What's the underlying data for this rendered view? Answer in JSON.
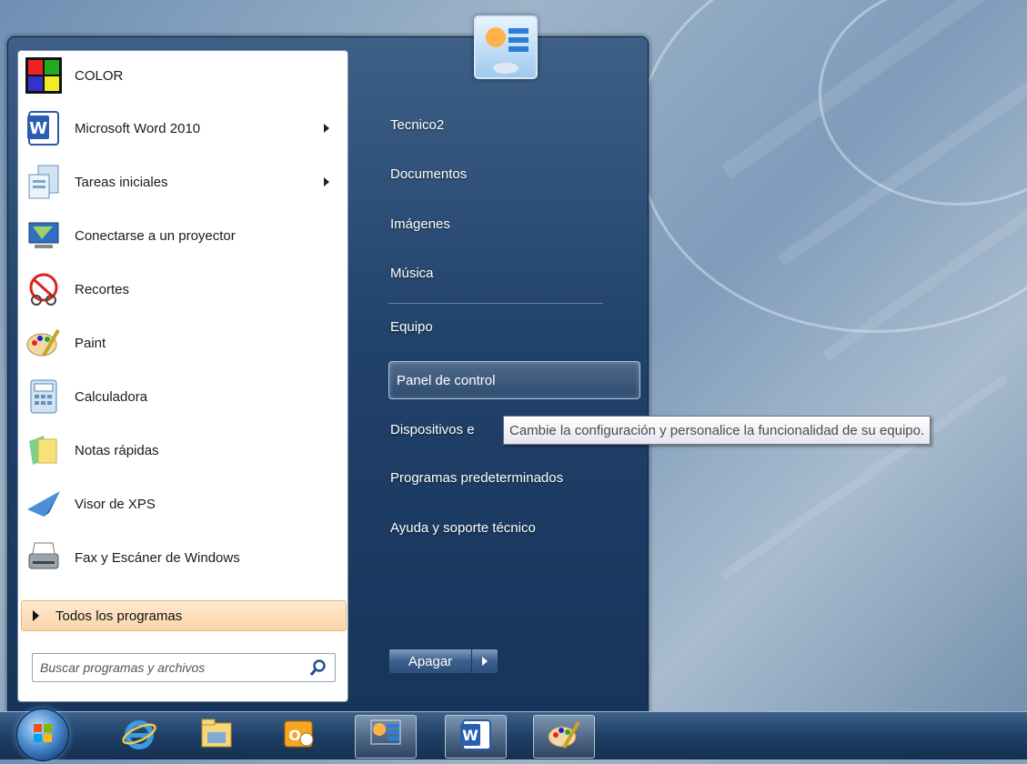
{
  "start_menu": {
    "programs": [
      {
        "label": "COLOR",
        "icon": "color-app-icon",
        "has_submenu": false
      },
      {
        "label": "Microsoft Word 2010",
        "icon": "word-icon",
        "has_submenu": true
      },
      {
        "label": "Tareas iniciales",
        "icon": "getting-started-icon",
        "has_submenu": true
      },
      {
        "label": "Conectarse a un proyector",
        "icon": "projector-icon",
        "has_submenu": false
      },
      {
        "label": "Recortes",
        "icon": "snipping-tool-icon",
        "has_submenu": false
      },
      {
        "label": "Paint",
        "icon": "paint-icon",
        "has_submenu": false
      },
      {
        "label": "Calculadora",
        "icon": "calculator-icon",
        "has_submenu": false
      },
      {
        "label": "Notas rápidas",
        "icon": "sticky-notes-icon",
        "has_submenu": false
      },
      {
        "label": "Visor de XPS",
        "icon": "xps-viewer-icon",
        "has_submenu": false
      },
      {
        "label": "Fax y Escáner de Windows",
        "icon": "fax-scanner-icon",
        "has_submenu": false
      }
    ],
    "all_programs_label": "Todos los programas",
    "search_placeholder": "Buscar programas y archivos",
    "places": [
      {
        "label": "Tecnico2"
      },
      {
        "label": "Documentos"
      },
      {
        "label": "Imágenes"
      },
      {
        "label": "Música"
      },
      {
        "label": "Equipo"
      },
      {
        "label": "Panel de control"
      },
      {
        "label": "Dispositivos e"
      },
      {
        "label": "Programas predeterminados"
      },
      {
        "label": "Ayuda y soporte técnico"
      }
    ],
    "shutdown_label": "Apagar",
    "tooltip": "Cambie la configuración y personalice la funcionalidad de su equipo."
  },
  "taskbar": {
    "items": [
      {
        "icon": "internet-explorer-icon",
        "active": false
      },
      {
        "icon": "file-explorer-icon",
        "active": false
      },
      {
        "icon": "outlook-icon",
        "active": false
      },
      {
        "icon": "control-panel-icon",
        "active": true
      },
      {
        "icon": "word-icon",
        "active": true
      },
      {
        "icon": "paint-icon",
        "active": true
      }
    ]
  },
  "colors": {
    "menu_dark": "#17345a",
    "highlight": "#fbd5a9",
    "tooltip_text": "#4c4c4c"
  }
}
